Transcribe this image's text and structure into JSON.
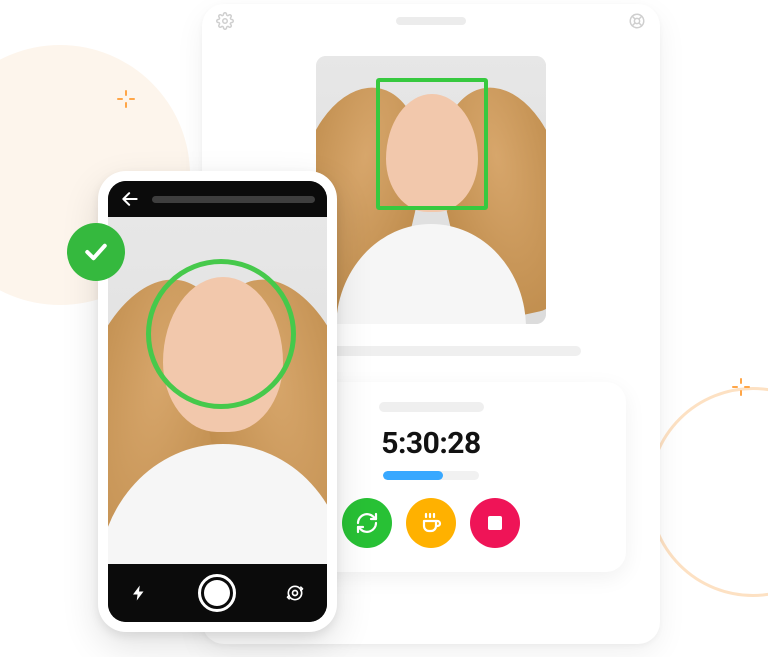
{
  "colors": {
    "detect_green": "#37c93f",
    "success_green": "#35b93e",
    "action_green": "#28c135",
    "action_orange": "#ffb100",
    "action_red": "#ef1457",
    "progress_blue": "#38a8ff"
  },
  "badge": {
    "icon": "check-icon"
  },
  "tablet": {
    "top_icons": {
      "left": "gear-icon",
      "right": "help-icon"
    },
    "photo": {
      "face_detection_shape": "rectangle",
      "detected": true
    },
    "timer": {
      "value": "5:30:28",
      "progress_percent": 62
    },
    "actions": [
      {
        "name": "start-button",
        "icon": "refresh-arrows-icon",
        "color": "green"
      },
      {
        "name": "break-button",
        "icon": "coffee-cup-icon",
        "color": "orange"
      },
      {
        "name": "stop-button",
        "icon": "stop-icon",
        "color": "red"
      }
    ]
  },
  "phone": {
    "top": {
      "back_icon": "arrow-left-icon"
    },
    "photo": {
      "face_detection_shape": "circle",
      "detected": true
    },
    "bottom": {
      "left_icon": "flash-icon",
      "center": "shutter-button",
      "right_icon": "switch-camera-icon"
    }
  }
}
